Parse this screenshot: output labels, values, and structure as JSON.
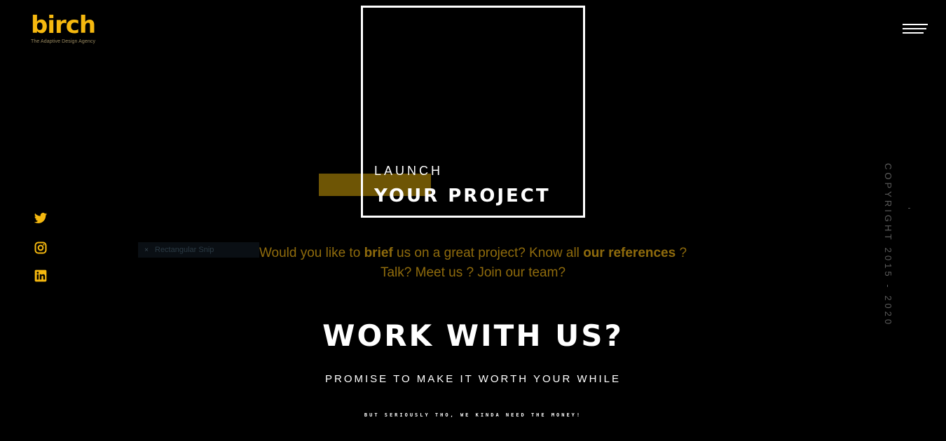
{
  "brand": {
    "name": "birch",
    "tagline": "The Adaptive Design Agency",
    "accent_color": "#f5b80f"
  },
  "header": {
    "menu_icon": "hamburger-icon"
  },
  "hero": {
    "launch": "LAUNCH",
    "project": "YOUR PROJECT"
  },
  "social": [
    {
      "name": "twitter",
      "icon": "twitter-icon"
    },
    {
      "name": "instagram",
      "icon": "instagram-icon"
    },
    {
      "name": "linkedin",
      "icon": "linkedin-icon"
    }
  ],
  "overlay": {
    "snip_label": "Rectangular Snip",
    "snip_close": "×"
  },
  "intro": {
    "part1": "Would you like to ",
    "brief": "brief",
    "part2": " us on a great project? Know all ",
    "references": "our references",
    "part3": " ?",
    "line2": "Talk? Meet us ? Join our team?"
  },
  "cta": {
    "headline": "WORK WITH US?",
    "promise": "PROMISE TO MAKE IT WORTH YOUR WHILE",
    "fine_print": "BUT SERIOUSLY THO, WE KINDA NEED THE MONEY!"
  },
  "footer": {
    "copyright": "COPYRIGHT 2015 - 2020"
  }
}
